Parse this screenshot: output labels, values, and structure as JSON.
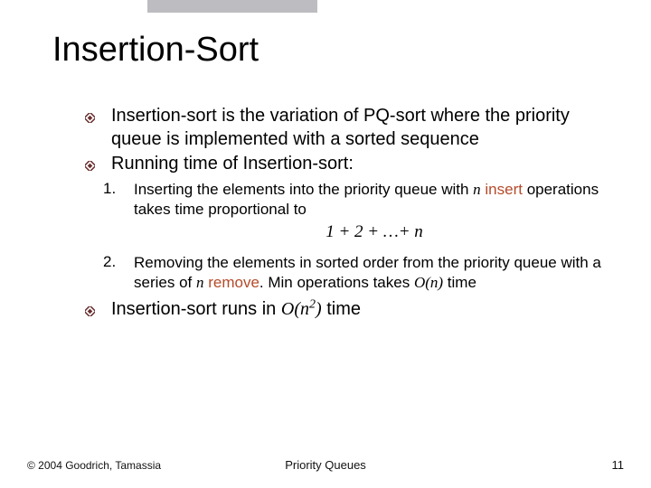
{
  "title": "Insertion-Sort",
  "bullets": {
    "b1": "Insertion-sort is the variation of PQ-sort where the priority queue is implemented with a sorted sequence",
    "b2": "Running time of Insertion-sort:",
    "b3_pre": "Insertion-sort runs in ",
    "b3_bigO": "O",
    "b3_paren_open": "(",
    "b3_nexp_n": "n",
    "b3_nexp_exp": "2",
    "b3_paren_close": ")",
    "b3_post": " time"
  },
  "numbered": {
    "n1_label": "1.",
    "n1_pre": "Inserting the elements into the priority queue with ",
    "n1_var": "n",
    "n1_mid": " ",
    "n1_kw": "insert",
    "n1_post": " operations takes time proportional to",
    "n1_formula": "1 + 2 + …+ n",
    "n2_label": "2.",
    "n2_pre": "Removing the elements in sorted order from the priority queue with  a series of ",
    "n2_var": "n",
    "n2_mid": " ",
    "n2_kw": "remove",
    "n2_kw2": ". Min",
    "n2_post": " operations takes ",
    "n2_O": "O",
    "n2_open": "(",
    "n2_n": "n",
    "n2_close": ")",
    "n2_tail": " time"
  },
  "footer": {
    "copyright": "© 2004 Goodrich, Tamassia",
    "center": "Priority Queues",
    "page": "11"
  }
}
